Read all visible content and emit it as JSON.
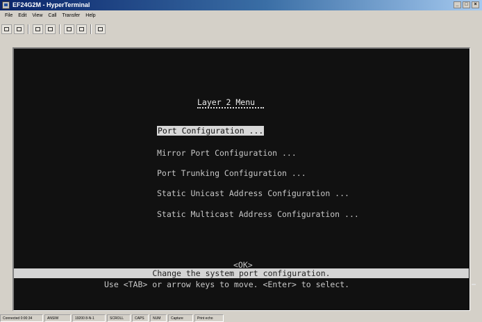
{
  "window": {
    "title": "EF24G2M - HyperTerminal",
    "icon": "terminal-app-icon"
  },
  "menubar": [
    "File",
    "Edit",
    "View",
    "Call",
    "Transfer",
    "Help"
  ],
  "toolbar": [
    "new-icon",
    "open-icon",
    "connect-icon",
    "disconnect-icon",
    "send-icon",
    "receive-icon",
    "properties-icon"
  ],
  "terminal": {
    "menu_title": "Layer 2 Menu",
    "options": [
      {
        "label": "Port Configuration ...",
        "selected": true
      },
      {
        "label": "Mirror Port Configuration ...",
        "selected": false
      },
      {
        "label": "Port Trunking Configuration ...",
        "selected": false
      },
      {
        "label": "Static Unicast Address Configuration ...",
        "selected": false
      },
      {
        "label": "Static Multicast Address Configuration ...",
        "selected": false
      }
    ],
    "ok_button": "<OK>",
    "status_text": "Change the system port configuration.",
    "help_text": "Use <TAB> or arrow keys to move. <Enter> to select."
  },
  "statusbar": [
    "Connected 0:00:34",
    "ANSIW",
    "19200 8-N-1",
    "SCROLL",
    "CAPS",
    "NUM",
    "Capture",
    "Print echo"
  ]
}
